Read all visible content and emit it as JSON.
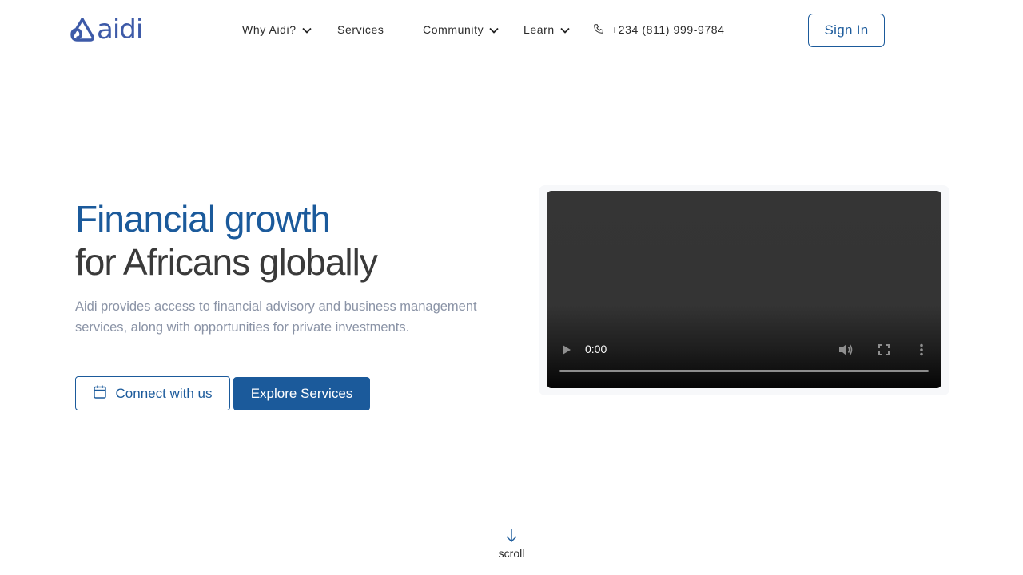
{
  "brand": {
    "logo_text": "aidi",
    "color": "#3d5aa8"
  },
  "nav": {
    "items": [
      {
        "label": "Why Aidi?",
        "has_dropdown": true
      },
      {
        "label": "Services",
        "has_dropdown": false
      },
      {
        "label": "Community",
        "has_dropdown": true
      },
      {
        "label": "Learn",
        "has_dropdown": true
      }
    ],
    "phone": "+234 (811) 999-9784",
    "signin_label": "Sign In"
  },
  "hero": {
    "title_line1": "Financial growth",
    "title_line2": "for Africans globally",
    "description": "Aidi provides access to financial advisory and business management services, along with opportunities for private investments.",
    "connect_label": "Connect with us",
    "explore_label": "Explore Services"
  },
  "video": {
    "time": "0:00"
  },
  "scroll": {
    "label": "scroll"
  },
  "colors": {
    "accent": "#1b5a9b",
    "muted_text": "#8a93a6"
  },
  "icons": [
    "chevron-down-icon",
    "phone-icon",
    "calendar-icon",
    "play-icon",
    "volume-icon",
    "fullscreen-icon",
    "more-icon",
    "arrow-down-icon"
  ]
}
